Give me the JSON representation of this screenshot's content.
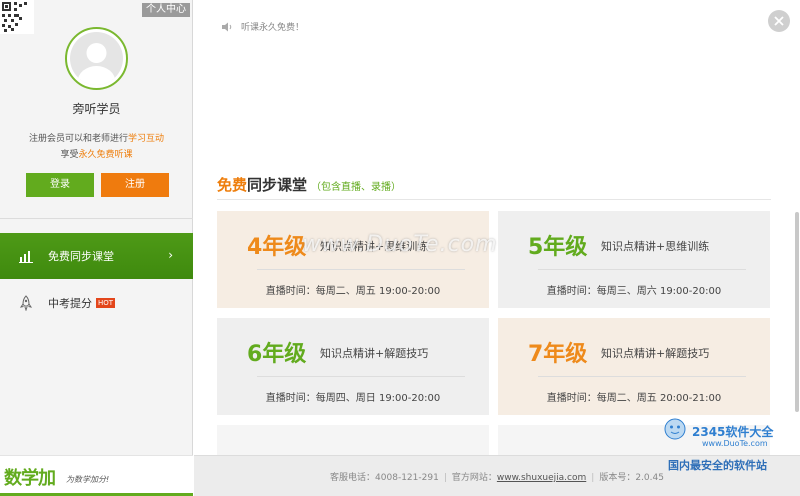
{
  "sidebar": {
    "personal_center": "个人中心",
    "username": "旁听学员",
    "desc_line1_prefix": "注册会员可以和老师进行",
    "desc_line1_highlight": "学习互动",
    "desc_line2_prefix": "享受",
    "desc_line2_highlight": "永久免费听课",
    "login_label": "登录",
    "register_label": "注册",
    "nav": [
      {
        "label": "免费同步课堂",
        "icon": "chart-icon",
        "active": true
      },
      {
        "label": "中考提分",
        "icon": "rocket-icon",
        "badge": "HOT"
      }
    ],
    "brand_logo": "数学加",
    "brand_slogan": "为数学加分!"
  },
  "main": {
    "notice": "听课永久免费！",
    "section_title_a": "免费",
    "section_title_b": "同步课堂",
    "section_title_sub": "（包含直播、录播）",
    "cards": [
      {
        "grade": "4年级",
        "title": "知识点精讲+思维训练",
        "time": "直播时间：每周二、周五  19:00-20:00"
      },
      {
        "grade": "5年级",
        "title": "知识点精讲+思维训练",
        "time": "直播时间：每周三、周六  19:00-20:00"
      },
      {
        "grade": "6年级",
        "title": "知识点精讲+解题技巧",
        "time": "直播时间：每周四、周日  19:00-20:00"
      },
      {
        "grade": "7年级",
        "title": "知识点精讲+解题技巧",
        "time": "直播时间：每周二、周五  20:00-21:00"
      }
    ],
    "footer": {
      "phone": "客服电话：4008-121-291",
      "website_label": "官方网站：",
      "website": "www.shuxuejia.com",
      "version": "版本号：2.0.45"
    }
  },
  "watermark": {
    "center": "www.DuoTe.com",
    "corner_brand": "2345软件大全",
    "corner_url": "www.DuoTe.com",
    "corner_slogan": "国内最安全的软件站"
  },
  "colors": {
    "green": "#62ab1e",
    "orange": "#ef7b0e"
  }
}
